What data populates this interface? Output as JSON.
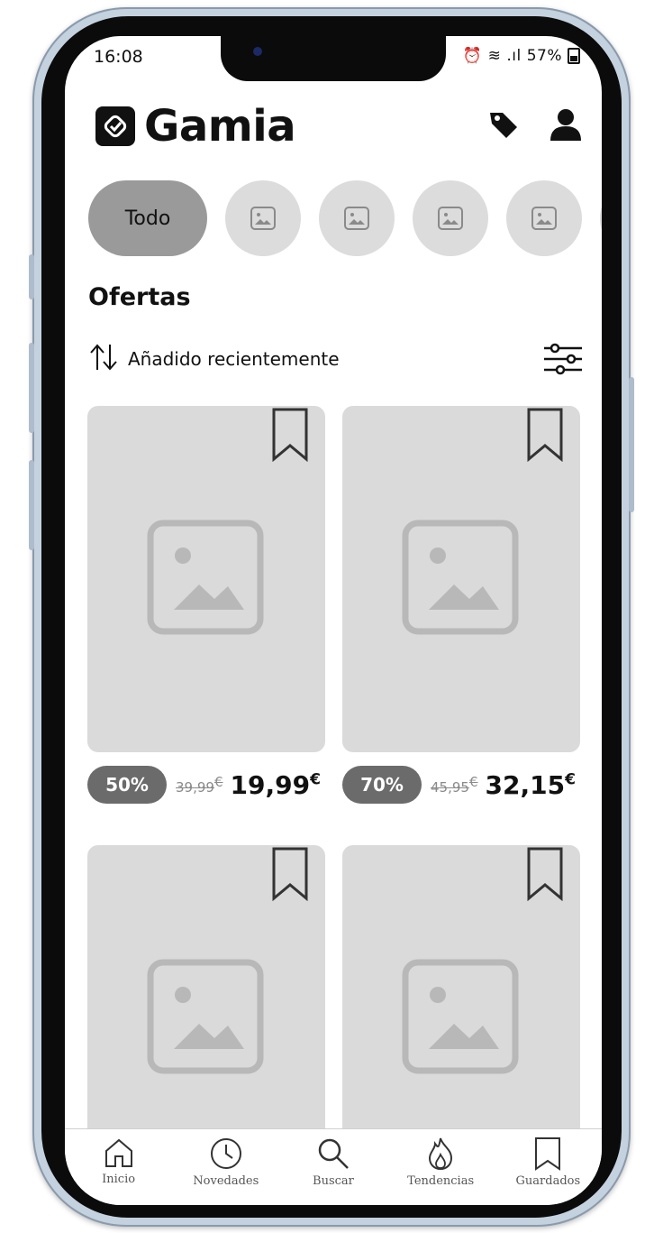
{
  "status_bar": {
    "time": "16:08",
    "battery": "57%"
  },
  "header": {
    "app_name": "Gamia"
  },
  "categories": {
    "first_chip": "Todo"
  },
  "section": {
    "title": "Ofertas"
  },
  "sort": {
    "label": "Añadido recientemente"
  },
  "products": [
    {
      "discount": "50%",
      "old_price": "39,99",
      "new_price": "19,99",
      "currency": "€"
    },
    {
      "discount": "70%",
      "old_price": "45,95",
      "new_price": "32,15",
      "currency": "€"
    }
  ],
  "tabbar": {
    "items": [
      {
        "label": "Inicio",
        "icon": "home-icon"
      },
      {
        "label": "Novedades",
        "icon": "clock-icon"
      },
      {
        "label": "Buscar",
        "icon": "search-icon"
      },
      {
        "label": "Tendencias",
        "icon": "flame-icon"
      },
      {
        "label": "Guardados",
        "icon": "bookmark-icon"
      }
    ]
  },
  "colors": {
    "chip_active": "#9a9a9a",
    "chip_inactive": "#dcdcdc",
    "card_bg": "#dadada",
    "badge_bg": "#6b6b6b",
    "frame": "#c4d1de"
  }
}
